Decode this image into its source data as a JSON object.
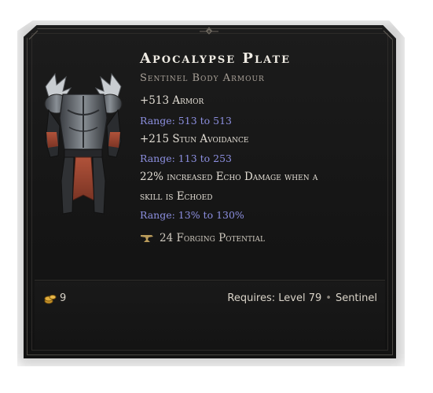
{
  "item": {
    "name": "Apocalypse Plate",
    "type": "Sentinel Body Armour",
    "affixes": [
      {
        "stat": "+513 Armor",
        "range": "Range: 513 to 513"
      },
      {
        "stat": "+215 Stun Avoidance",
        "range": "Range: 113 to 253"
      },
      {
        "stat_line1": "22% increased Echo Damage when a",
        "stat_line2": "skill is Echoed",
        "range": "Range: 13% to 130%"
      }
    ],
    "forging": {
      "text": "24 Forging Potential",
      "icon": "anvil-icon"
    }
  },
  "footer": {
    "gold_value": "9",
    "gold_icon": "gold-coins-icon",
    "requires": "Requires: Level 79",
    "class": "Sentinel"
  },
  "colors": {
    "title": "#f0ece4",
    "subtitle": "#a9a198",
    "stat": "#e2ddd4",
    "range": "#8c8fe0",
    "panel": "#171717",
    "gold": "#d9a72e"
  }
}
